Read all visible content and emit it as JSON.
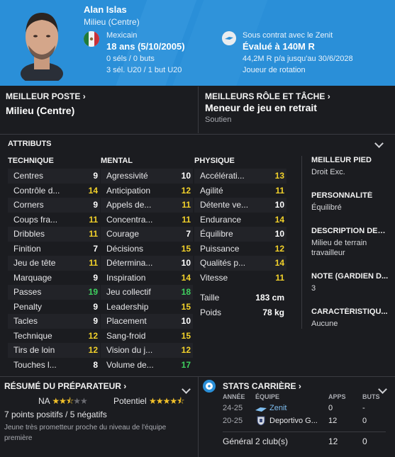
{
  "player": {
    "name": "Alan Islas",
    "position": "Milieu (Centre)",
    "nationality": "Mexicain",
    "age": "18 ans (5/10/2005)",
    "caps": "0 séls / 0 buts",
    "u20": "3 sél. U20 / 1 but U20",
    "contract": "Sous contrat avec le Zenit",
    "value": "Évalué à 140M R",
    "wage": "44,2M R p/a jusqu'au 30/6/2028",
    "squad_role": "Joueur de rotation"
  },
  "best_position": {
    "label": "MEILLEUR POSTE",
    "value": "Milieu (Centre)"
  },
  "best_role": {
    "label": "MEILLEURS RÔLE ET TÂCHE",
    "value": "Meneur de jeu en retrait",
    "duty": "Soutien"
  },
  "attributes": {
    "title": "ATTRIBUTS",
    "technical": {
      "title": "TECHNIQUE",
      "rows": [
        {
          "label": "Centres",
          "value": "9",
          "tier": "white"
        },
        {
          "label": "Contrôle d...",
          "value": "14",
          "tier": "yellow"
        },
        {
          "label": "Corners",
          "value": "9",
          "tier": "white"
        },
        {
          "label": "Coups fra...",
          "value": "11",
          "tier": "yellow"
        },
        {
          "label": "Dribbles",
          "value": "11",
          "tier": "yellow"
        },
        {
          "label": "Finition",
          "value": "7",
          "tier": "white"
        },
        {
          "label": "Jeu de tête",
          "value": "11",
          "tier": "yellow"
        },
        {
          "label": "Marquage",
          "value": "9",
          "tier": "white"
        },
        {
          "label": "Passes",
          "value": "19",
          "tier": "green"
        },
        {
          "label": "Penalty",
          "value": "9",
          "tier": "white"
        },
        {
          "label": "Tacles",
          "value": "9",
          "tier": "white"
        },
        {
          "label": "Technique",
          "value": "12",
          "tier": "yellow"
        },
        {
          "label": "Tirs de loin",
          "value": "12",
          "tier": "yellow"
        },
        {
          "label": "Touches l...",
          "value": "8",
          "tier": "white"
        }
      ]
    },
    "mental": {
      "title": "MENTAL",
      "rows": [
        {
          "label": "Agressivité",
          "value": "10",
          "tier": "white"
        },
        {
          "label": "Anticipation",
          "value": "12",
          "tier": "yellow"
        },
        {
          "label": "Appels de...",
          "value": "11",
          "tier": "yellow"
        },
        {
          "label": "Concentra...",
          "value": "11",
          "tier": "yellow"
        },
        {
          "label": "Courage",
          "value": "7",
          "tier": "white"
        },
        {
          "label": "Décisions",
          "value": "15",
          "tier": "yellow"
        },
        {
          "label": "Détermina...",
          "value": "10",
          "tier": "white"
        },
        {
          "label": "Inspiration",
          "value": "14",
          "tier": "yellow"
        },
        {
          "label": "Jeu collectif",
          "value": "18",
          "tier": "green"
        },
        {
          "label": "Leadership",
          "value": "15",
          "tier": "yellow"
        },
        {
          "label": "Placement",
          "value": "10",
          "tier": "white"
        },
        {
          "label": "Sang-froid",
          "value": "15",
          "tier": "yellow"
        },
        {
          "label": "Vision du j...",
          "value": "12",
          "tier": "yellow"
        },
        {
          "label": "Volume de...",
          "value": "17",
          "tier": "green"
        }
      ]
    },
    "physical": {
      "title": "PHYSIQUE",
      "rows": [
        {
          "label": "Accélérati...",
          "value": "13",
          "tier": "yellow"
        },
        {
          "label": "Agilité",
          "value": "11",
          "tier": "yellow"
        },
        {
          "label": "Détente ve...",
          "value": "10",
          "tier": "white"
        },
        {
          "label": "Endurance",
          "value": "14",
          "tier": "yellow"
        },
        {
          "label": "Équilibre",
          "value": "10",
          "tier": "white"
        },
        {
          "label": "Puissance",
          "value": "12",
          "tier": "yellow"
        },
        {
          "label": "Qualités p...",
          "value": "14",
          "tier": "yellow"
        },
        {
          "label": "Vitesse",
          "value": "11",
          "tier": "yellow"
        }
      ],
      "height_label": "Taille",
      "height": "183 cm",
      "weight_label": "Poids",
      "weight": "78 kg"
    }
  },
  "side_info": [
    {
      "title": "MEILLEUR PIED",
      "value": "Droit Exc."
    },
    {
      "title": "PERSONNALITÉ",
      "value": "Équilibré"
    },
    {
      "title": "DESCRIPTION DES...",
      "value": "Milieu de terrain travailleur"
    },
    {
      "title": "NOTE (GARDIEN D...",
      "value": "3"
    },
    {
      "title": "CARACTÉRISTIQU...",
      "value": "Aucune"
    }
  ],
  "scout": {
    "title": "RÉSUMÉ DU PRÉPARATEUR",
    "current_label": "NA",
    "current_stars": 2.5,
    "potential_label": "Potentiel",
    "potential_stars": 4.5,
    "summary": "7 points positifs / 5 négatifs",
    "note": "Jeune très prometteur proche du niveau de l'équipe première"
  },
  "career": {
    "title": "STATS CARRIÈRE",
    "headers": {
      "season": "ANNÉE",
      "team": "ÉQUIPE",
      "apps": "APPS",
      "goals": "BUTS"
    },
    "rows": [
      {
        "season": "24-25",
        "team": "Zenit",
        "apps": "0",
        "goals": "-"
      },
      {
        "season": "20-25",
        "team": "Deportivo G...",
        "apps": "12",
        "goals": "0"
      }
    ],
    "total": {
      "label": "Général",
      "clubs": "2 club(s)",
      "apps": "12",
      "goals": "0"
    }
  },
  "colors": {
    "header_bg": "#2a8fd8",
    "background": "#1b1c20",
    "yellow": "#f2d12a",
    "green": "#3fd05f",
    "link": "#7fbef0"
  }
}
